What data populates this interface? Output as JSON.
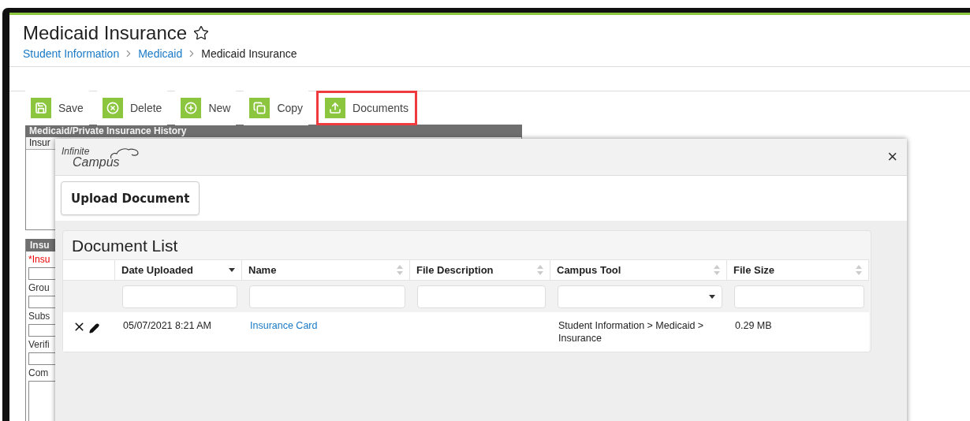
{
  "page": {
    "title": "Medicaid Insurance",
    "favorite": false
  },
  "breadcrumb": [
    {
      "label": "Student Information",
      "link": true
    },
    {
      "label": "Medicaid",
      "link": true
    },
    {
      "label": "Medicaid Insurance",
      "link": false
    }
  ],
  "toolbar": [
    {
      "label": "Save",
      "kind": "save",
      "highlighted": false
    },
    {
      "label": "Delete",
      "kind": "delete",
      "highlighted": false
    },
    {
      "label": "New",
      "kind": "new",
      "highlighted": false
    },
    {
      "label": "Copy",
      "kind": "copy",
      "highlighted": false
    },
    {
      "label": "Documents",
      "kind": "upload",
      "highlighted": true
    }
  ],
  "history_panel": {
    "title": "Medicaid/Private Insurance History",
    "column_1": "Insur"
  },
  "detail_panel": {
    "title": "Insu",
    "fields": [
      {
        "label": "*Insu",
        "required": true,
        "kind": "input"
      },
      {
        "label": "Grou",
        "required": false,
        "kind": "input"
      },
      {
        "label": "Subs",
        "required": false,
        "kind": "input"
      },
      {
        "label": "Verifi",
        "required": false,
        "kind": "input"
      },
      {
        "label": "Com",
        "required": false,
        "kind": "textarea"
      }
    ]
  },
  "modal": {
    "logo": {
      "line_1": "Infinite",
      "line_2": "Campus"
    },
    "close": "×",
    "upload_button": "Upload Document",
    "list": {
      "title": "Document List",
      "columns": [
        {
          "label": "Date Uploaded",
          "sorted": true,
          "kind": "text"
        },
        {
          "label": "Name",
          "sorted": false,
          "kind": "text"
        },
        {
          "label": "File Description",
          "sorted": false,
          "kind": "text"
        },
        {
          "label": "Campus Tool",
          "sorted": false,
          "kind": "select"
        },
        {
          "label": "File Size",
          "sorted": false,
          "kind": "text"
        }
      ],
      "rows": [
        {
          "date_uploaded": "05/07/2021 8:21 AM",
          "name": "Insurance Card",
          "campus_tool": "Student Information > Medicaid > Insurance",
          "file_size": "0.29 MB"
        }
      ]
    }
  }
}
